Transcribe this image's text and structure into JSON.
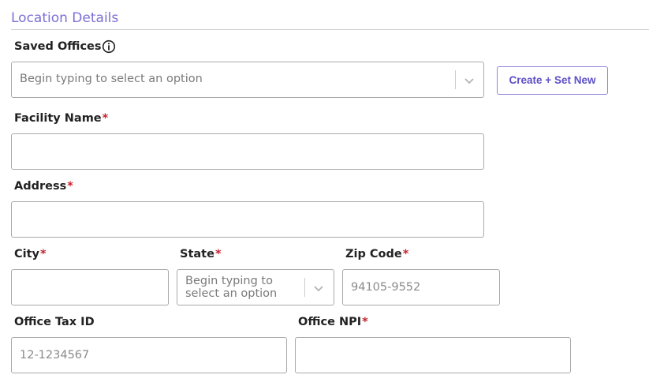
{
  "section": {
    "title": "Location Details"
  },
  "saved_offices": {
    "label": "Saved Offices",
    "placeholder": "Begin typing to select an option",
    "create_button": "Create + Set New"
  },
  "facility_name": {
    "label": "Facility Name",
    "required_mark": "*",
    "value": ""
  },
  "address": {
    "label": "Address",
    "required_mark": "*",
    "value": ""
  },
  "city": {
    "label": "City",
    "required_mark": "*",
    "value": ""
  },
  "state": {
    "label": "State",
    "required_mark": "*",
    "placeholder_line1": "Begin typing to",
    "placeholder_line2": "select an option"
  },
  "zip_code": {
    "label": "Zip Code",
    "required_mark": "*",
    "placeholder": "94105-9552"
  },
  "office_tax_id": {
    "label": "Office Tax ID",
    "placeholder": "12-1234567"
  },
  "office_npi": {
    "label": "Office NPI",
    "required_mark": "*",
    "value": ""
  },
  "colors": {
    "accent": "#7b6fd6",
    "button_text": "#5b50c7",
    "required": "#c8202e",
    "border": "#a9a9a9"
  },
  "icons": {
    "info": "info-circle-icon",
    "dropdown": "chevron-down-icon"
  }
}
